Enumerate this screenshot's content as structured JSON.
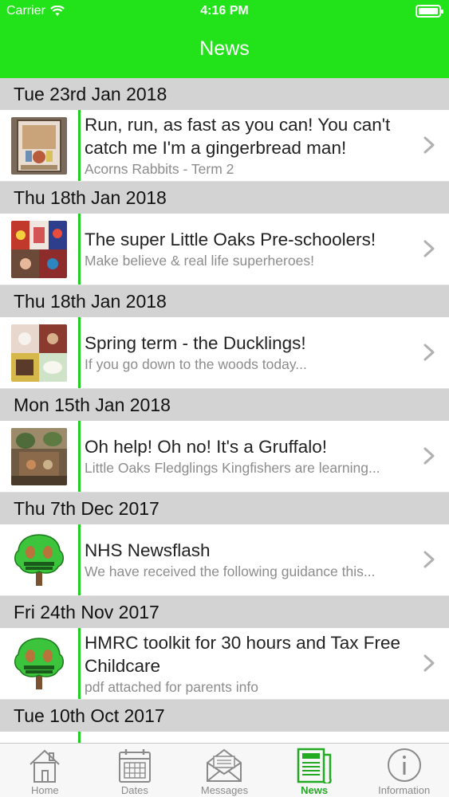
{
  "status_bar": {
    "carrier": "Carrier",
    "time": "4:16 PM",
    "battery_level": 1.0
  },
  "nav": {
    "title": "News"
  },
  "colors": {
    "header": "#22e31a",
    "accent_rule": "#22cc22",
    "section_bg": "#d3d3d3",
    "active_tab": "#22aa22"
  },
  "news": [
    {
      "date": "Tue 23rd Jan 2018",
      "title": "Run, run, as fast as you can! You can't catch me I'm a gingerbread man!",
      "subtitle": "Acorns Rabbits - Term 2",
      "thumb": "gingerbread-photo-icon"
    },
    {
      "date": "Thu 18th Jan 2018",
      "title": "The super Little Oaks Pre-schoolers!",
      "subtitle": "Make believe & real life superheroes!",
      "thumb": "superheroes-collage-icon"
    },
    {
      "date": "Thu 18th Jan 2018",
      "title": "Spring term - the Ducklings!",
      "subtitle": "If you go down to the woods today...",
      "thumb": "ducklings-collage-icon"
    },
    {
      "date": "Mon 15th Jan 2018",
      "title": "Oh help! Oh no! It's a Gruffalo!",
      "subtitle": "Little Oaks Fledglings Kingfishers are learning...",
      "thumb": "gruffalo-photo-icon"
    },
    {
      "date": "Thu 7th Dec 2017",
      "title": "NHS Newsflash",
      "subtitle": "We have received the following guidance this...",
      "thumb": "oak-tree-logo-icon"
    },
    {
      "date": "Fri 24th Nov 2017",
      "title": "HMRC toolkit for 30 hours and Tax Free Childcare",
      "subtitle": "pdf attached for parents info",
      "thumb": "oak-tree-logo-icon"
    },
    {
      "date": "Tue 10th Oct 2017",
      "title": "",
      "subtitle": "",
      "thumb": "oak-tree-logo-icon"
    }
  ],
  "tabs": [
    {
      "label": "Home",
      "icon": "house-icon",
      "active": false
    },
    {
      "label": "Dates",
      "icon": "calendar-icon",
      "active": false
    },
    {
      "label": "Messages",
      "icon": "envelope-icon",
      "active": false
    },
    {
      "label": "News",
      "icon": "newspaper-icon",
      "active": true
    },
    {
      "label": "Information",
      "icon": "info-circle-icon",
      "active": false
    }
  ]
}
